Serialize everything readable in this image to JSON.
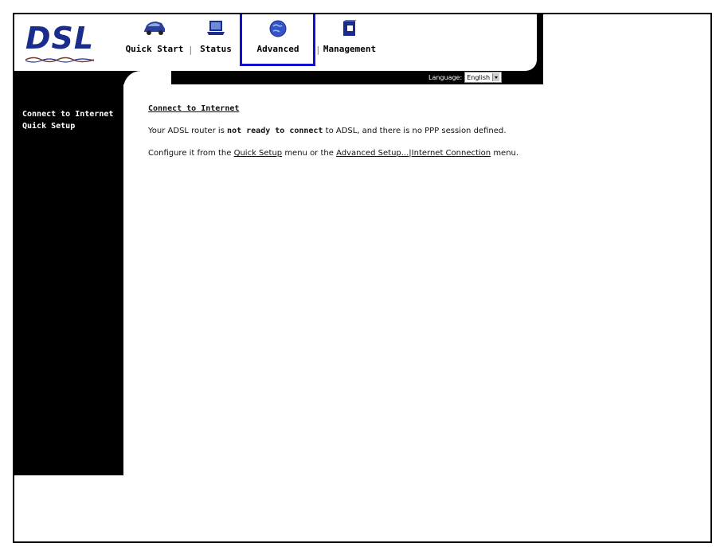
{
  "brand": {
    "logo_text": "DSL"
  },
  "nav": {
    "items": [
      {
        "label": "Quick Start",
        "icon": "car-icon"
      },
      {
        "label": "Status",
        "icon": "laptop-icon"
      },
      {
        "label": "Advanced",
        "icon": "globe-icon",
        "selected": true
      },
      {
        "label": "Management",
        "icon": "folder-icon"
      }
    ],
    "separator": "|"
  },
  "language": {
    "label": "Language:",
    "selected": "English"
  },
  "sidebar": {
    "items": [
      {
        "label": "Connect to Internet"
      },
      {
        "label": "Quick Setup"
      }
    ]
  },
  "main": {
    "title": "Connect to Internet",
    "line1": {
      "prefix": "Your ADSL router is ",
      "bold": "not ready to connect",
      "suffix": " to ADSL, and there is no PPP session defined."
    },
    "line2": {
      "prefix": "Configure it from the ",
      "link1": "Quick Setup",
      "middle": " menu or the ",
      "link2": "Advanced Setup...|Internet Connection",
      "suffix": " menu."
    }
  },
  "colors": {
    "selection_border": "#1010d0",
    "logo_blue": "#1a2d8c",
    "sidebar_bg": "#000000"
  }
}
